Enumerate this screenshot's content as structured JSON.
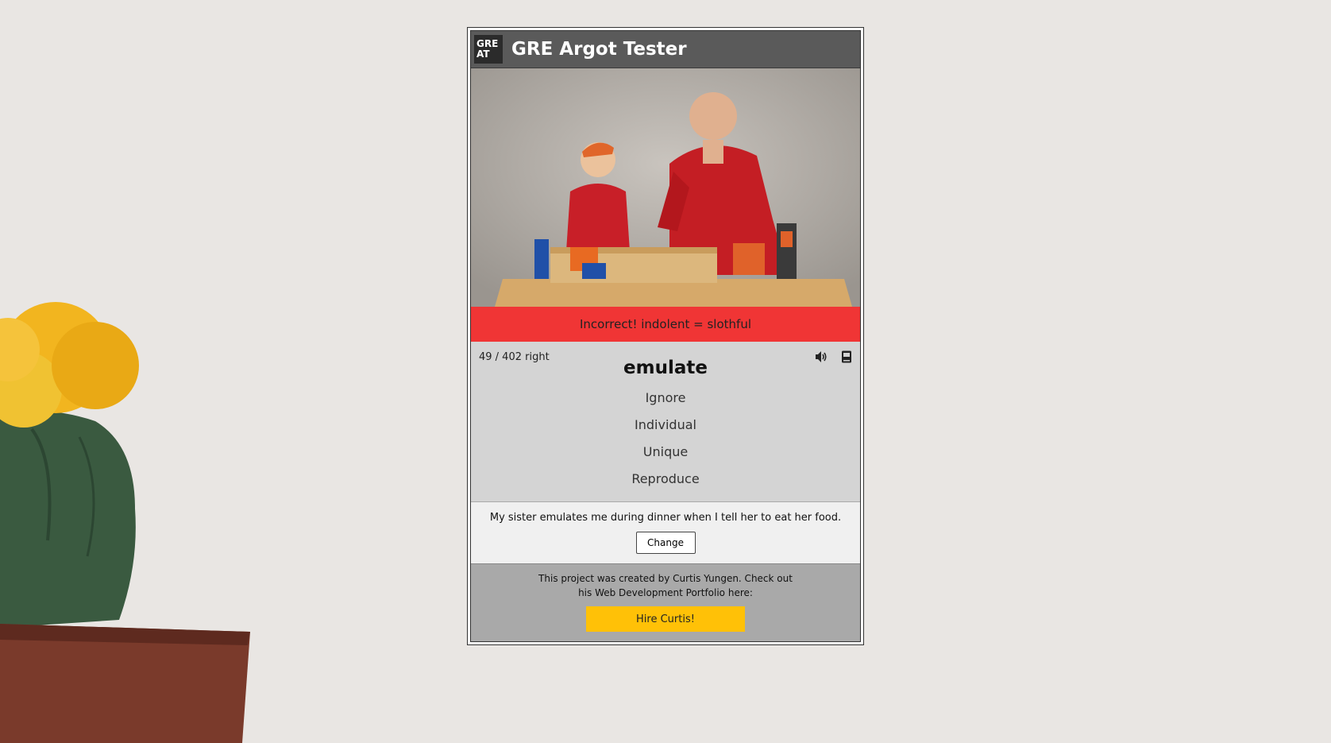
{
  "app": {
    "logo_line1": "GRE",
    "logo_line2": "AT",
    "title": "GRE Argot Tester"
  },
  "feedback": {
    "message": "Incorrect! indolent = slothful",
    "color": "#f03535"
  },
  "quiz": {
    "score": "49 / 402 right",
    "word": "emulate",
    "options": [
      "Ignore",
      "Individual",
      "Unique",
      "Reproduce"
    ],
    "icons": [
      "speaker-icon",
      "book-icon"
    ]
  },
  "example": {
    "sentence": "My sister emulates me during dinner when I tell her to eat her food.",
    "change_label": "Change"
  },
  "footer": {
    "text": "This project was created by Curtis Yungen. Check out his Web Development Portfolio here:",
    "hire_label": "Hire Curtis!",
    "hire_color": "#ffc107"
  }
}
